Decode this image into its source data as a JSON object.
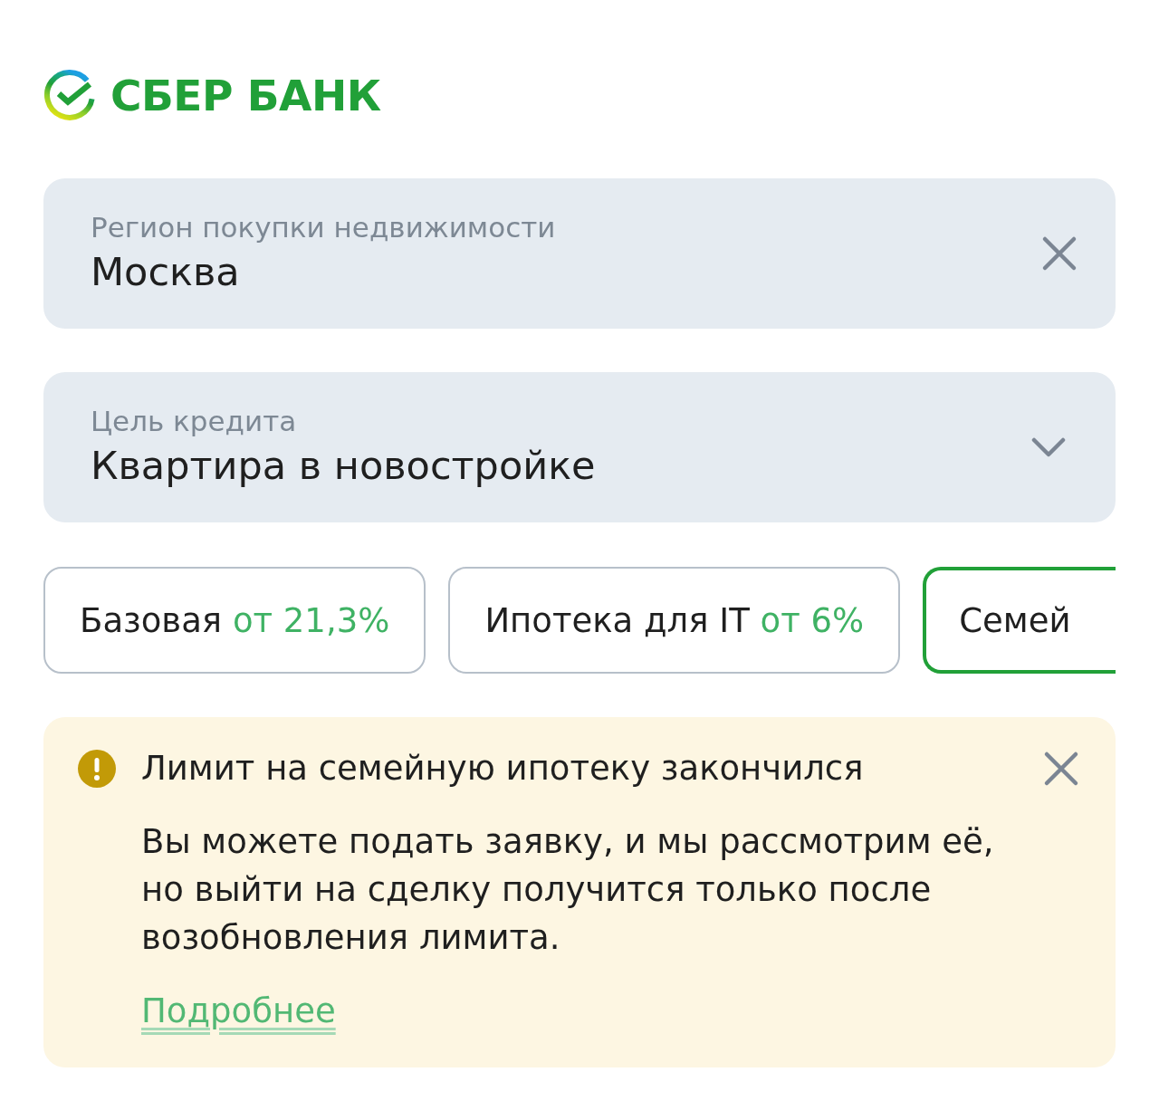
{
  "logo": {
    "text": "СБЕР БАНК"
  },
  "fields": [
    {
      "kind": "text",
      "label": "Регион покупки недвижимости",
      "value": "Москва"
    },
    {
      "kind": "select",
      "label": "Цель кредита",
      "value": "Квартира в новостройке"
    }
  ],
  "programs": [
    {
      "name": "Базовая",
      "rate": "от 21,3%",
      "selected": false
    },
    {
      "name": "Ипотека для IT",
      "rate": "от 6%",
      "selected": false
    },
    {
      "name": "Семей",
      "selected": true
    }
  ],
  "alert": {
    "title": "Лимит на семейную ипотеку закончился",
    "text": "Вы можете подать заявку, и мы рассмотрим её, но выйти на сделку получится только после возобновления лимита.",
    "link": "Подробнее"
  }
}
